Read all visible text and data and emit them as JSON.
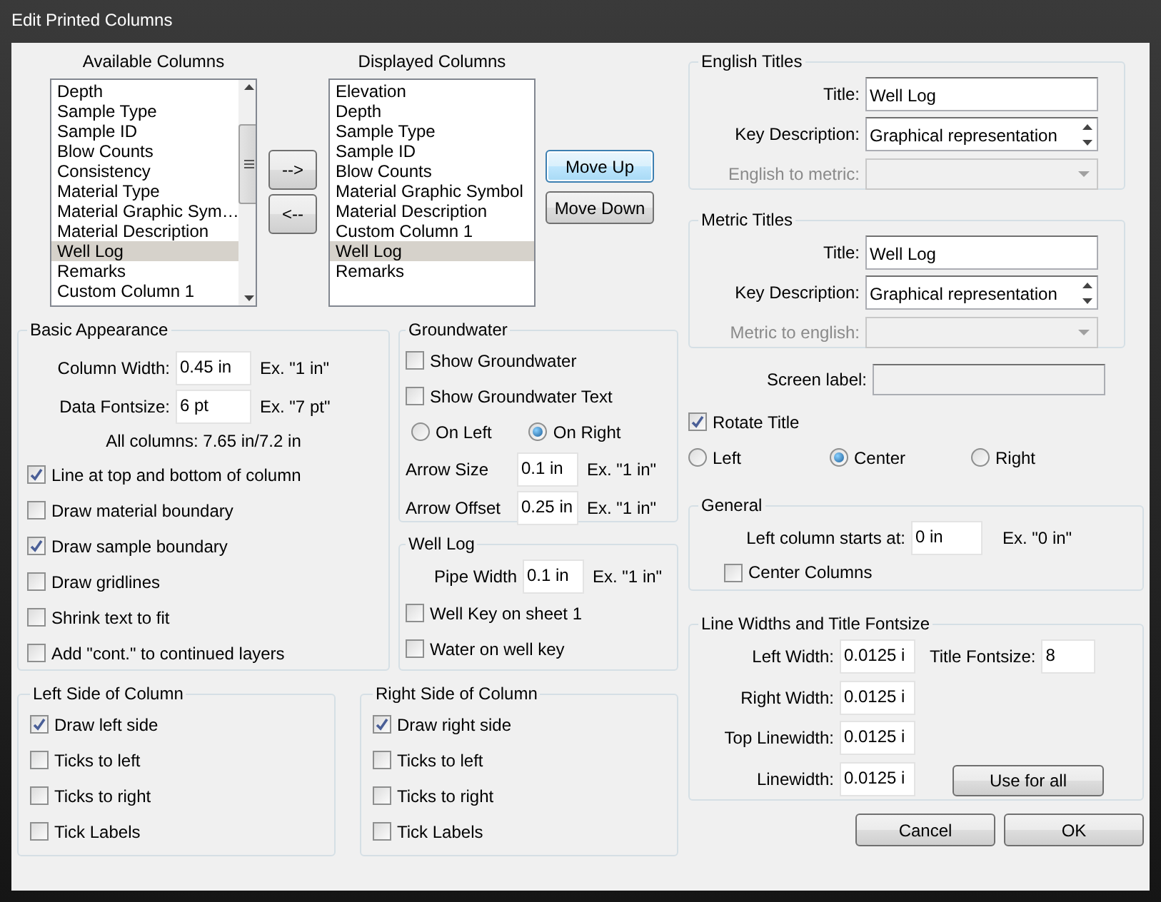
{
  "window": {
    "title": "Edit Printed Columns"
  },
  "available_columns": {
    "heading": "Available Columns",
    "items": [
      {
        "label": "Depth",
        "selected": false
      },
      {
        "label": "Sample Type",
        "selected": false
      },
      {
        "label": "Sample ID",
        "selected": false
      },
      {
        "label": "Blow Counts",
        "selected": false
      },
      {
        "label": "Consistency",
        "selected": false
      },
      {
        "label": "Material Type",
        "selected": false
      },
      {
        "label": "Material Graphic Sym…",
        "selected": false
      },
      {
        "label": "Material Description",
        "selected": false
      },
      {
        "label": "Well Log",
        "selected": true
      },
      {
        "label": "Remarks",
        "selected": false
      },
      {
        "label": "Custom Column 1",
        "selected": false
      }
    ]
  },
  "transfer_buttons": [
    "-->",
    "<--"
  ],
  "displayed_columns": {
    "heading": "Displayed Columns",
    "items": [
      {
        "label": "Elevation",
        "selected": false
      },
      {
        "label": "Depth",
        "selected": false
      },
      {
        "label": "Sample Type",
        "selected": false
      },
      {
        "label": "Sample ID",
        "selected": false
      },
      {
        "label": "Blow Counts",
        "selected": false
      },
      {
        "label": "Material Graphic Symbol",
        "selected": false
      },
      {
        "label": "Material Description",
        "selected": false
      },
      {
        "label": "Custom Column 1",
        "selected": false
      },
      {
        "label": "Well Log",
        "selected": true
      },
      {
        "label": "Remarks",
        "selected": false
      }
    ]
  },
  "order_buttons": [
    {
      "label": "Move Up",
      "focused": true
    },
    {
      "label": "Move Down",
      "focused": false
    }
  ],
  "basic_appearance": {
    "title": "Basic Appearance",
    "fields": [
      {
        "label": "Column Width:",
        "value": "0.45 in",
        "example": "Ex. \"1 in\""
      },
      {
        "label": "Data Fontsize:",
        "value": "6 pt",
        "example": "Ex. \"7 pt\""
      }
    ],
    "summary": "All columns: 7.65 in/7.2 in",
    "options": [
      {
        "label": "Line at top and bottom of column",
        "checked": true
      },
      {
        "label": "Draw material boundary",
        "checked": false
      },
      {
        "label": "Draw sample boundary",
        "checked": true
      },
      {
        "label": "Draw gridlines",
        "checked": false
      },
      {
        "label": "Shrink text to fit",
        "checked": false
      },
      {
        "label": "Add \"cont.\" to continued layers",
        "checked": false
      }
    ]
  },
  "groundwater": {
    "title": "Groundwater",
    "options": [
      {
        "label": "Show Groundwater",
        "checked": false
      },
      {
        "label": "Show Groundwater Text",
        "checked": false
      }
    ],
    "side": [
      {
        "label": "On Left",
        "selected": false
      },
      {
        "label": "On Right",
        "selected": true
      }
    ],
    "fields": [
      {
        "label": "Arrow Size",
        "value": "0.1 in",
        "example": "Ex. \"1 in\""
      },
      {
        "label": "Arrow Offset",
        "value": "0.25 in",
        "example": "Ex. \"1 in\""
      }
    ]
  },
  "well_log": {
    "title": "Well Log",
    "fields": [
      {
        "label": "Pipe Width",
        "value": "0.1 in",
        "example": "Ex. \"1 in\""
      }
    ],
    "options": [
      {
        "label": "Well Key on sheet 1",
        "checked": false
      },
      {
        "label": "Water on well key",
        "checked": false
      }
    ]
  },
  "left_side": {
    "title": "Left Side of Column",
    "options": [
      {
        "label": "Draw left side",
        "checked": true
      },
      {
        "label": "Ticks to left",
        "checked": false
      },
      {
        "label": "Ticks to right",
        "checked": false
      },
      {
        "label": "Tick Labels",
        "checked": false
      }
    ]
  },
  "right_side": {
    "title": "Right Side of Column",
    "options": [
      {
        "label": "Draw right side",
        "checked": true
      },
      {
        "label": "Ticks to left",
        "checked": false
      },
      {
        "label": "Ticks to right",
        "checked": false
      },
      {
        "label": "Tick Labels",
        "checked": false
      }
    ]
  },
  "english_titles": {
    "title": "English Titles",
    "fields": [
      {
        "kind": "text",
        "label": "Title:",
        "value": "Well Log",
        "disabled": false
      },
      {
        "kind": "textarea",
        "label": "Key Description:",
        "value": "Graphical representation",
        "disabled": false
      },
      {
        "kind": "select",
        "label": "English to metric:",
        "disabled": true
      }
    ]
  },
  "metric_titles": {
    "title": "Metric Titles",
    "fields": [
      {
        "kind": "text",
        "label": "Title:",
        "value": "Well Log",
        "disabled": false
      },
      {
        "kind": "textarea",
        "label": "Key Description:",
        "value": "Graphical representation",
        "disabled": false
      },
      {
        "kind": "select",
        "label": "Metric to english:",
        "disabled": true
      }
    ]
  },
  "screen_label": {
    "label": "Screen label:",
    "disabled": true
  },
  "rotate_title": {
    "label": "Rotate Title",
    "checked": true
  },
  "alignment": [
    {
      "label": "Left",
      "selected": false
    },
    {
      "label": "Center",
      "selected": true
    },
    {
      "label": "Right",
      "selected": false
    }
  ],
  "general": {
    "title": "General",
    "fields": [
      {
        "label": "Left column starts at:",
        "value": "0 in",
        "example": "Ex. \"0 in\""
      }
    ],
    "options": [
      {
        "label": "Center Columns",
        "checked": false
      }
    ]
  },
  "line_widths": {
    "title": "Line Widths and Title Fontsize",
    "fields": [
      {
        "label": "Left Width:",
        "value": "0.0125 i"
      },
      {
        "label": "Right Width:",
        "value": "0.0125 i"
      },
      {
        "label": "Top Linewidth:",
        "value": "0.0125 i"
      },
      {
        "label": "Linewidth:",
        "value": "0.0125 i"
      }
    ],
    "title_fontsize": {
      "label": "Title Fontsize:",
      "value": "8"
    },
    "button": "Use for all"
  },
  "dialog_buttons": [
    "Cancel",
    "OK"
  ]
}
